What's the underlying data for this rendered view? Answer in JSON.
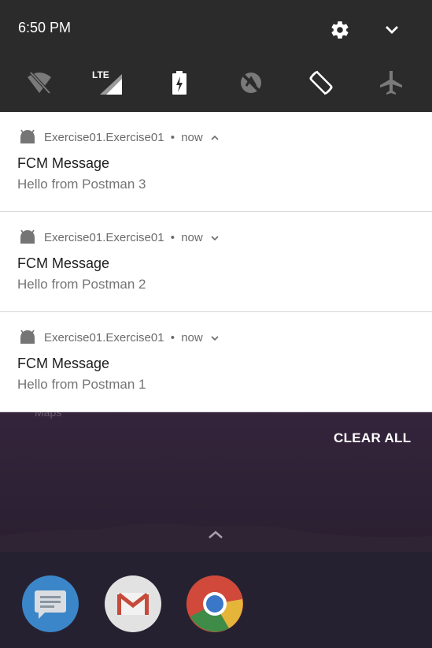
{
  "status_bar": {
    "time": "6:50 PM",
    "quick_settings": [
      {
        "icon": "wifi-off-icon"
      },
      {
        "icon": "lte-signal-icon",
        "label": "LTE"
      },
      {
        "icon": "battery-saver-icon"
      },
      {
        "icon": "location-off-icon"
      },
      {
        "icon": "auto-rotate-icon"
      },
      {
        "icon": "airplane-mode-icon"
      }
    ]
  },
  "notifications": [
    {
      "app": "Exercise01.Exercise01",
      "sep": "•",
      "time": "now",
      "expanded": true,
      "title": "FCM Message",
      "body": "Hello from Postman 3"
    },
    {
      "app": "Exercise01.Exercise01",
      "sep": "•",
      "time": "now",
      "expanded": false,
      "title": "FCM Message",
      "body": "Hello from Postman 2"
    },
    {
      "app": "Exercise01.Exercise01",
      "sep": "•",
      "time": "now",
      "expanded": false,
      "title": "FCM Message",
      "body": "Hello from Postman 1"
    }
  ],
  "clear_all_label": "CLEAR ALL",
  "home": {
    "maps_label": "Maps",
    "dock": [
      {
        "icon": "messages-icon"
      },
      {
        "icon": "gmail-icon"
      },
      {
        "icon": "chrome-icon"
      }
    ]
  },
  "colors": {
    "panel": "#2b2b2b",
    "notification_bg": "#ffffff",
    "secondary_text": "#757575"
  }
}
